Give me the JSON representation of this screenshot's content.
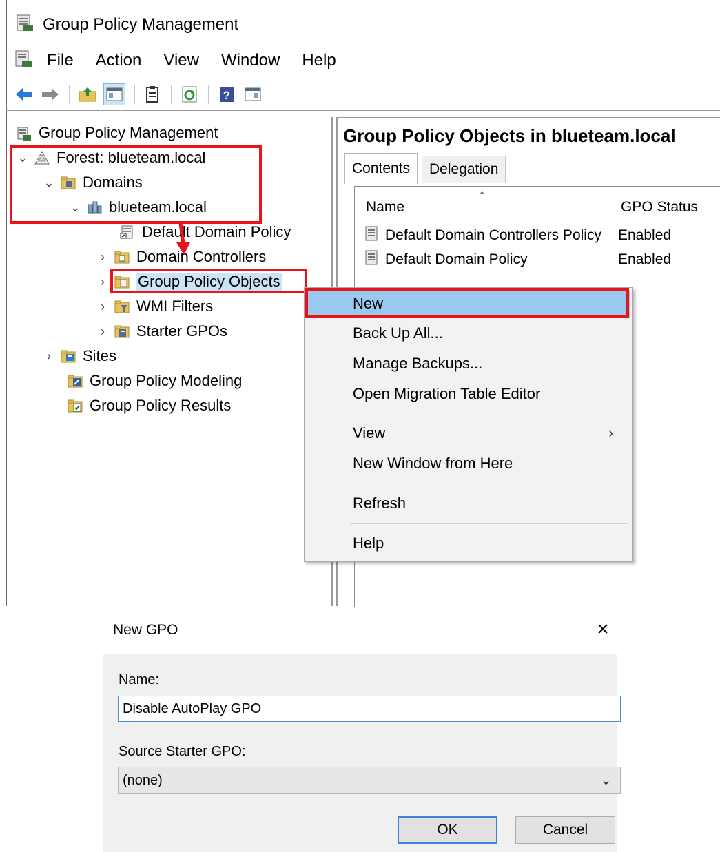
{
  "window": {
    "title": "Group Policy Management"
  },
  "menu": [
    "File",
    "Action",
    "View",
    "Window",
    "Help"
  ],
  "toolbar": {
    "icons": [
      "back-arrow-icon",
      "forward-arrow-icon",
      "up-folder-icon",
      "show-hide-tree-icon",
      "properties-icon",
      "refresh-icon",
      "help-icon",
      "action-pane-icon"
    ]
  },
  "tree": {
    "root": "Group Policy Management",
    "forest": "Forest: blueteam.local",
    "domains": "Domains",
    "domain": "blueteam.local",
    "children": [
      "Default Domain Policy",
      "Domain Controllers",
      "Group Policy Objects",
      "WMI Filters",
      "Starter GPOs"
    ],
    "sites": "Sites",
    "modeling": "Group Policy Modeling",
    "results": "Group Policy Results"
  },
  "right": {
    "title": "Group Policy Objects in blueteam.local",
    "tabs": [
      "Contents",
      "Delegation"
    ],
    "columns": [
      "Name",
      "GPO Status"
    ],
    "rows": [
      {
        "name": "Default Domain Controllers Policy",
        "status": "Enabled"
      },
      {
        "name": "Default Domain Policy",
        "status": "Enabled"
      }
    ]
  },
  "context_menu": {
    "items": [
      "New",
      "Back Up All...",
      "Manage Backups...",
      "Open Migration Table Editor",
      "View",
      "New Window from Here",
      "Refresh",
      "Help"
    ],
    "highlighted": "New"
  },
  "dialog": {
    "title": "New GPO",
    "name_label": "Name:",
    "name_value": "Disable AutoPlay GPO",
    "source_label": "Source Starter GPO:",
    "source_value": "(none)",
    "ok": "OK",
    "cancel": "Cancel"
  },
  "colors": {
    "highlight": "#99c9ef",
    "annotation": "#e8141b",
    "focus": "#3b84d6"
  }
}
